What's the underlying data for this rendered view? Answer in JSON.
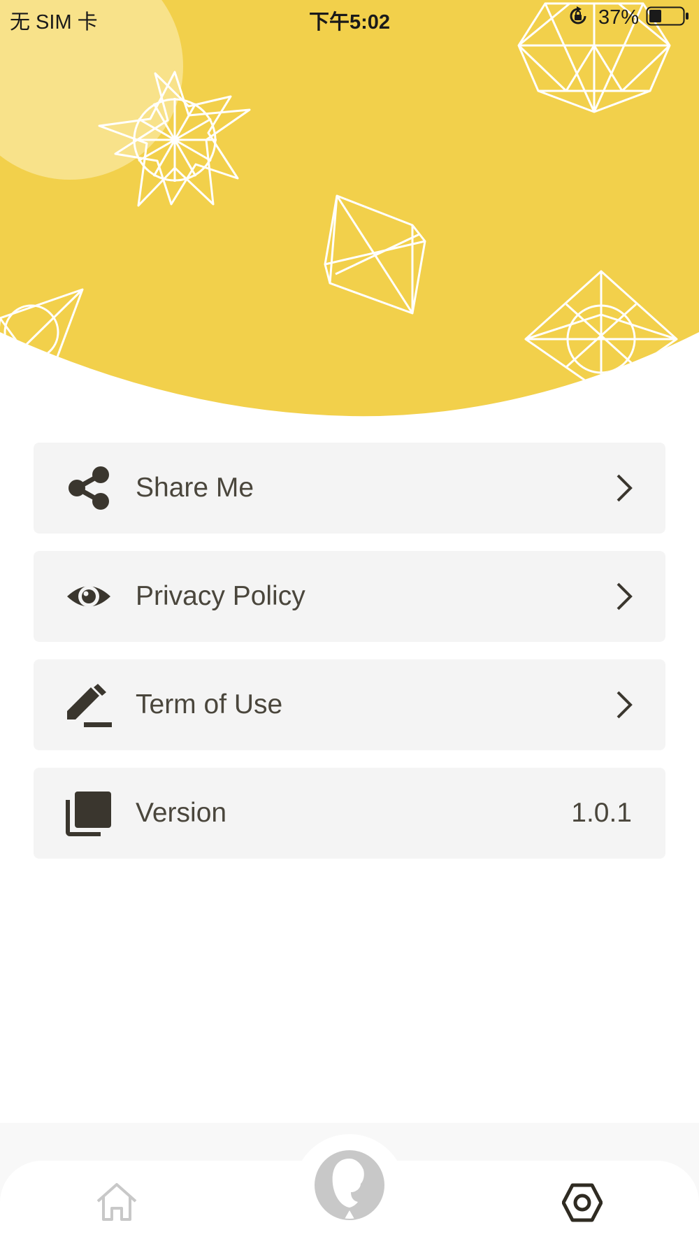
{
  "status_bar": {
    "carrier": "无 SIM 卡",
    "time": "下午5:02",
    "battery_percent": "37%",
    "battery_level": 0.37
  },
  "header": {
    "background_color": "#f2d04b",
    "highlight_color": "#f8e28a",
    "line_color": "#ffffff"
  },
  "menu": {
    "items": [
      {
        "label": "Share Me",
        "icon": "share-icon",
        "action": "chevron-right-icon"
      },
      {
        "label": "Privacy Policy",
        "icon": "eye-icon",
        "action": "chevron-right-icon"
      },
      {
        "label": "Term of Use",
        "icon": "pencil-icon",
        "action": "chevron-right-icon"
      },
      {
        "label": "Version",
        "icon": "layers-icon",
        "value": "1.0.1"
      }
    ]
  },
  "tab_bar": {
    "tabs": [
      {
        "icon": "home-icon",
        "active": false
      },
      {
        "icon": "profile-avatar-icon",
        "active": false
      },
      {
        "icon": "settings-icon",
        "active": true
      }
    ],
    "active_color": "#2f2b22",
    "inactive_color": "#c8c8c8"
  },
  "colors": {
    "card_background": "#f4f4f4",
    "text": "#4a463c",
    "icon": "#3a362e"
  }
}
